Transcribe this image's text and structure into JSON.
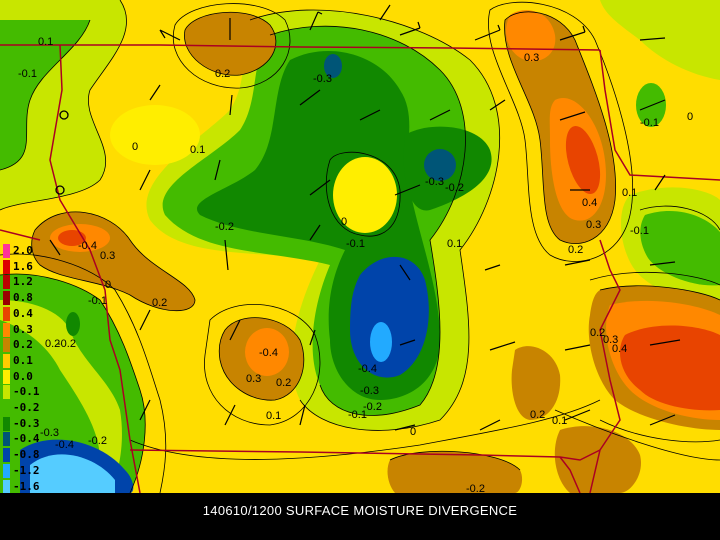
{
  "title": "140610/1200 SURFACE MOISTURE DIVERGENCE",
  "legend": [
    {
      "label": "2.0",
      "color": "#ff3399"
    },
    {
      "label": "1.6",
      "color": "#dd0000"
    },
    {
      "label": "1.2",
      "color": "#bb0000"
    },
    {
      "label": "0.8",
      "color": "#990000"
    },
    {
      "label": "0.4",
      "color": "#e84400"
    },
    {
      "label": "0.3",
      "color": "#ff8800"
    },
    {
      "label": "0.2",
      "color": "#c88400"
    },
    {
      "label": "0.1",
      "color": "#ffcc00"
    },
    {
      "label": "0.0",
      "color": "#ffee00"
    },
    {
      "label": "-0.1",
      "color": "#c8e600"
    },
    {
      "label": "-0.2",
      "color": "#44bb00"
    },
    {
      "label": "-0.3",
      "color": "#118800"
    },
    {
      "label": "-0.4",
      "color": "#005577"
    },
    {
      "label": "-0.8",
      "color": "#0044aa"
    },
    {
      "label": "-1.2",
      "color": "#22aaff"
    },
    {
      "label": "-1.6",
      "color": "#55ccff"
    },
    {
      "label": "",
      "color": "#9933cc"
    }
  ],
  "contour_labels": [
    "0.1",
    "-0.1",
    "0.2",
    "-0.3",
    "0.3",
    "0.1",
    "0",
    "-0.1",
    "0",
    "-0.3",
    "-0.2",
    "0.4",
    "0.1",
    "0.3",
    "-0.1",
    "-0.2",
    "0",
    "-0.1",
    "0.1",
    "0.2",
    "-0.4",
    "0.3",
    "0.2",
    "-0.1",
    "0.2",
    "-0.2",
    "-0.4",
    "0.3",
    "0.2",
    "-0.4",
    "-0.3",
    "-0.2",
    "-0.1",
    "0.1",
    "0",
    "0.2",
    "0.1",
    "0.2",
    "0.3",
    "0.4",
    "-0.3",
    "-0.4",
    "-0.2",
    "-0.2",
    "0"
  ]
}
